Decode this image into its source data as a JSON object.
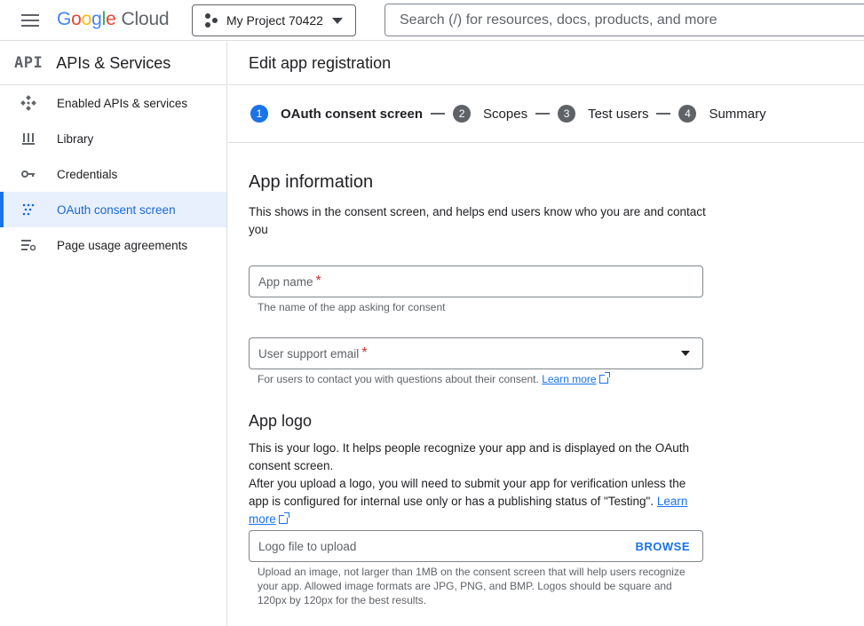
{
  "topbar": {
    "logo_letters": [
      "G",
      "o",
      "o",
      "g",
      "l",
      "e"
    ],
    "logo_suffix": "Cloud",
    "project_name": "My Project 70422",
    "search_placeholder": "Search (/) for resources, docs, products, and more"
  },
  "sidebar": {
    "badge": "API",
    "title": "APIs & Services",
    "items": [
      {
        "label": "Enabled APIs & services",
        "icon": "api-diamond-icon",
        "active": false
      },
      {
        "label": "Library",
        "icon": "library-icon",
        "active": false
      },
      {
        "label": "Credentials",
        "icon": "key-icon",
        "active": false
      },
      {
        "label": "OAuth consent screen",
        "icon": "oauth-dots-icon",
        "active": true
      },
      {
        "label": "Page usage agreements",
        "icon": "settings-list-icon",
        "active": false
      }
    ]
  },
  "main": {
    "title": "Edit app registration",
    "steps": [
      {
        "num": "1",
        "label": "OAuth consent screen",
        "active": true
      },
      {
        "num": "2",
        "label": "Scopes",
        "active": false
      },
      {
        "num": "3",
        "label": "Test users",
        "active": false
      },
      {
        "num": "4",
        "label": "Summary",
        "active": false
      }
    ],
    "app_info": {
      "heading": "App information",
      "description": "This shows in the consent screen, and helps end users know who you are and contact you",
      "app_name_label": "App name",
      "app_name_helper": "The name of the app asking for consent",
      "email_label": "User support email",
      "email_helper": "For users to contact you with questions about their consent.",
      "learn_more": "Learn more",
      "required_mark": "*"
    },
    "app_logo": {
      "heading": "App logo",
      "description_1": "This is your logo. It helps people recognize your app and is displayed on the OAuth consent screen.",
      "description_2": "After you upload a logo, you will need to submit your app for verification unless the app is configured for internal use only or has a publishing status of \"Testing\".",
      "learn_more": "Learn more",
      "upload_label": "Logo file to upload",
      "browse_label": "BROWSE",
      "upload_helper": "Upload an image, not larger than 1MB on the consent screen that will help users recognize your app. Allowed image formats are JPG, PNG, and BMP. Logos should be square and 120px by 120px for the best results."
    }
  },
  "colors": {
    "accent": "#1a73e8",
    "active_bg": "#e8f0fe",
    "required": "#d93025"
  }
}
